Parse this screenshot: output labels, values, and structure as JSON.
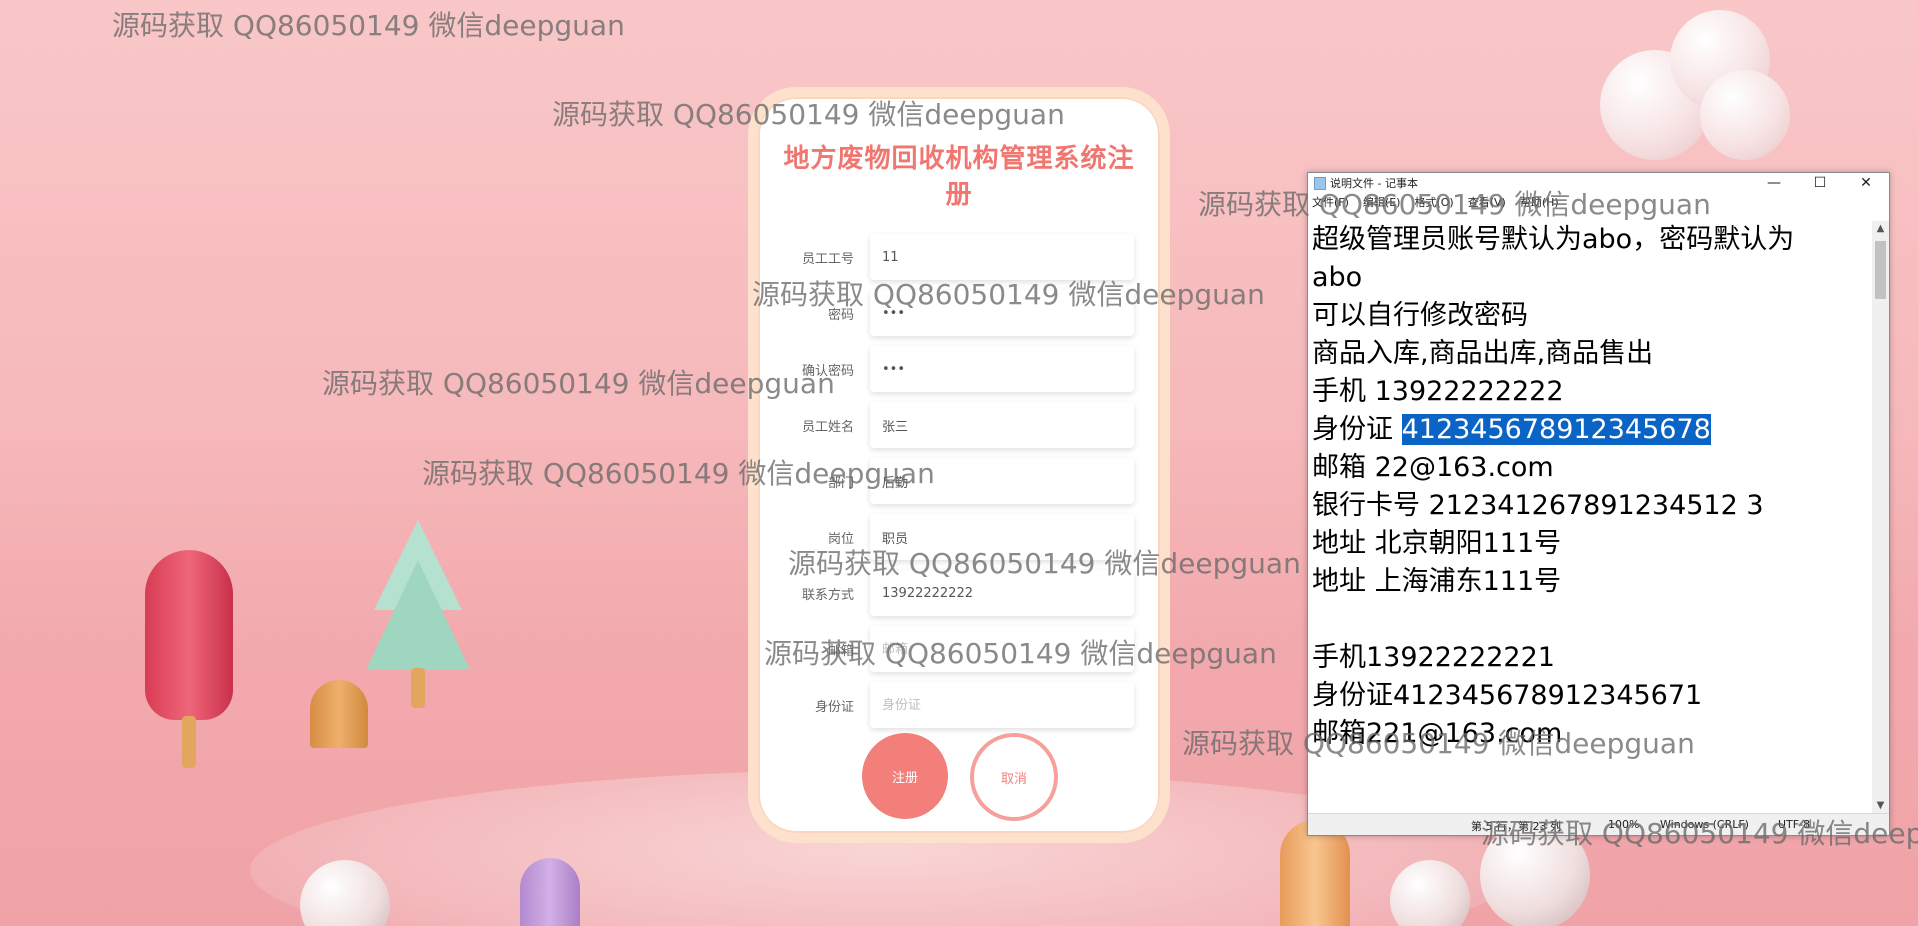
{
  "form": {
    "title": "地方废物回收机构管理系统注册",
    "fields": [
      {
        "label": "员工工号",
        "value": "11",
        "placeholder": "员工工号"
      },
      {
        "label": "密码",
        "value": "•••",
        "placeholder": "密码"
      },
      {
        "label": "确认密码",
        "value": "•••",
        "placeholder": "确认密码"
      },
      {
        "label": "员工姓名",
        "value": "张三",
        "placeholder": "员工姓名"
      },
      {
        "label": "部门",
        "value": "后勤",
        "placeholder": "部门"
      },
      {
        "label": "岗位",
        "value": "职员",
        "placeholder": "岗位"
      },
      {
        "label": "联系方式",
        "value": "13922222222",
        "placeholder": "联系方式"
      },
      {
        "label": "邮箱",
        "value": "",
        "placeholder": "邮箱"
      },
      {
        "label": "身份证",
        "value": "",
        "placeholder": "身份证"
      }
    ],
    "register_label": "注册",
    "cancel_label": "取消"
  },
  "notepad": {
    "title": "说明文件 - 记事本",
    "menu": [
      "文件(F)",
      "编辑(E)",
      "格式(O)",
      "查看(V)",
      "帮助(H)"
    ],
    "window_buttons": {
      "minimize": "—",
      "maximize": "☐",
      "close": "✕"
    },
    "lines_before": "超级管理员账号默认为abo，密码默认为\nabo\n可以自行修改密码\n商品入库,商品出库,商品售出\n手机 13922222222\n身份证 ",
    "selected_text": "412345678912345678",
    "lines_after": "\n邮箱 22@163.com\n银行卡号 212341267891234512 3\n地址 北京朝阳111号\n地址 上海浦东111号\n\n手机13922222221\n身份证412345678912345671\n邮箱221@163.com",
    "status": {
      "position": "第 5 行，第 23 列",
      "zoom": "100%",
      "line_ending": "Windows (CRLF)",
      "encoding": "UTF-8"
    }
  },
  "watermark": "源码获取 QQ86050149 微信deepguan"
}
